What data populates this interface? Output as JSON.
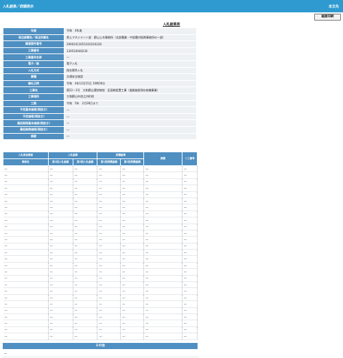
{
  "header": {
    "title": "入札結果／詳細表示",
    "corner": "本文先"
  },
  "print_button": "画面印刷",
  "doc_title": "入札結果表",
  "info_rows": [
    {
      "label": "年度",
      "value": "令和　4年度"
    },
    {
      "label": "発注部署名／発注所属名",
      "value": "県土マネジメント部　郡山土木事務所（北部農業・中部農村振興事務所の一部）"
    },
    {
      "label": "調達案件番号",
      "value": "29001013051020220228"
    },
    {
      "label": "工事番号",
      "value": "130510040230"
    },
    {
      "label": "工事番号名称",
      "value": "―"
    },
    {
      "label": "電子／紙",
      "value": "電子入札"
    },
    {
      "label": "入札方式",
      "value": "指名競争入札"
    },
    {
      "label": "業種",
      "value": "交通安全施設"
    },
    {
      "label": "開札日時",
      "value": "令和　4年12月15日 10時30分"
    },
    {
      "label": "工事名",
      "value": "第22ー1号　大和郡山環状線他　区画線設置工事（道路施設保存修繕事業）"
    },
    {
      "label": "工事場所",
      "value": "大和郡山市池之内町他"
    },
    {
      "label": "工期",
      "value": "令和　5年　2月28日まで"
    },
    {
      "label": "予定基本価格(税抜き)",
      "value": "―"
    },
    {
      "label": "予定価格(税抜き)",
      "value": "―"
    },
    {
      "label": "最低制限基本価格(税抜き)",
      "value": "―"
    },
    {
      "label": "最低制限価格(税抜き)",
      "value": "―"
    },
    {
      "label": "摘要",
      "value": "―"
    }
  ],
  "results_table": {
    "header_top": [
      "入札参加業者",
      "入札結果",
      "見積結果",
      "摘要",
      "くじ番号"
    ],
    "header_sub": [
      "業者名",
      "第1回入札金額",
      "第2回入札金額",
      "第1回見積金額",
      "第2回見積金額"
    ],
    "rows": [
      [
        "―",
        "―",
        "―",
        "―",
        "―",
        "―",
        "―"
      ],
      [
        "―",
        "―",
        "―",
        "―",
        "―",
        "―",
        "―"
      ],
      [
        "―",
        "―",
        "―",
        "―",
        "―",
        "―",
        "―"
      ],
      [
        "―",
        "―",
        "―",
        "―",
        "―",
        "―",
        "―"
      ],
      [
        "―",
        "―",
        "―",
        "―",
        "―",
        "―",
        "―"
      ],
      [
        "―",
        "―",
        "―",
        "―",
        "―",
        "―",
        "―"
      ],
      [
        "―",
        "―",
        "―",
        "―",
        "―",
        "―",
        "―"
      ],
      [
        "―",
        "―",
        "―",
        "―",
        "―",
        "―",
        "―"
      ],
      [
        "―",
        "―",
        "―",
        "―",
        "―",
        "―",
        "―"
      ],
      [
        "―",
        "―",
        "―",
        "―",
        "―",
        "―",
        "―"
      ],
      [
        "―",
        "―",
        "―",
        "―",
        "―",
        "―",
        "―"
      ],
      [
        "―",
        "―",
        "―",
        "―",
        "―",
        "―",
        "―"
      ],
      [
        "―",
        "―",
        "―",
        "―",
        "―",
        "―",
        "―"
      ],
      [
        "―",
        "―",
        "―",
        "―",
        "―",
        "―",
        "―"
      ],
      [
        "―",
        "―",
        "―",
        "―",
        "―",
        "―",
        "―"
      ],
      [
        "―",
        "―",
        "―",
        "―",
        "―",
        "―",
        "―"
      ],
      [
        "―",
        "―",
        "―",
        "―",
        "―",
        "―",
        "―"
      ],
      [
        "―",
        "―",
        "―",
        "―",
        "―",
        "―",
        "―"
      ],
      [
        "―",
        "―",
        "―",
        "―",
        "―",
        "―",
        "―"
      ],
      [
        "―",
        "―",
        "―",
        "―",
        "―",
        "―",
        "―"
      ],
      [
        "―",
        "―",
        "―",
        "―",
        "―",
        "―",
        "―"
      ],
      [
        "―",
        "―",
        "―",
        "―",
        "―",
        "―",
        "―"
      ],
      [
        "―",
        "―",
        "―",
        "―",
        "―",
        "―",
        "―"
      ],
      [
        "―",
        "―",
        "―",
        "―",
        "―",
        "―",
        "―"
      ],
      [
        "―",
        "―",
        "―",
        "―",
        "―",
        "―",
        "―"
      ],
      [
        "―",
        "―",
        "―",
        "―",
        "―",
        "―",
        "―"
      ],
      [
        "―",
        "―",
        "―",
        "―",
        "―",
        "―",
        "―"
      ]
    ]
  },
  "other": {
    "label": "その他",
    "value": "―"
  }
}
